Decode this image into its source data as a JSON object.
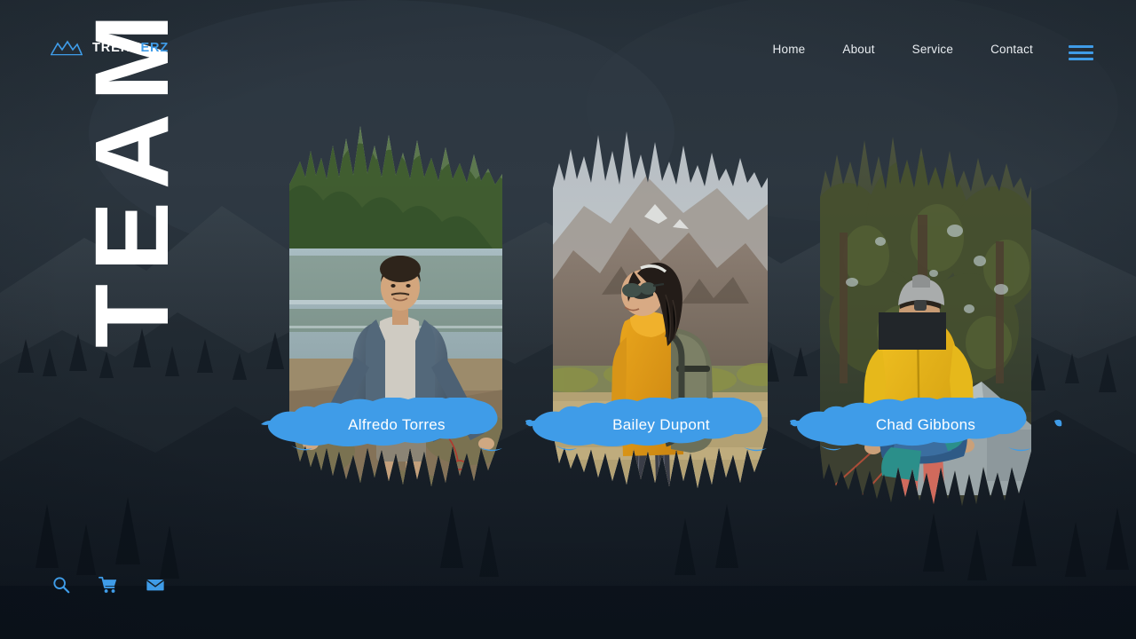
{
  "site": {
    "brand_primary": "TREKK",
    "brand_accent": "ERZ",
    "logo_icon": "mountain-icon",
    "accent_color": "#3f9ce8",
    "background_color": "#1d2731",
    "text_color": "#ffffff"
  },
  "nav": {
    "items": [
      {
        "label": "Home"
      },
      {
        "label": "About"
      },
      {
        "label": "Service"
      },
      {
        "label": "Contact"
      }
    ],
    "menu_icon": "hamburger-menu-icon"
  },
  "hero": {
    "section_title": "TEAM"
  },
  "team": {
    "members": [
      {
        "name": "Alfredo Torres",
        "photo_alt": "man in denim jacket standing by a lake",
        "badge_color": "#3f9ce8"
      },
      {
        "name": "Bailey Dupont",
        "photo_alt": "woman with sunglasses and green backpack in the desert",
        "badge_color": "#3f9ce8"
      },
      {
        "name": "Chad Gibbons",
        "photo_alt": "man in yellow jacket setting up a tent in the forest",
        "badge_color": "#3f9ce8"
      }
    ]
  },
  "utility": {
    "icons": [
      {
        "name": "search-icon",
        "label": "Search"
      },
      {
        "name": "cart-icon",
        "label": "Cart"
      },
      {
        "name": "mail-icon",
        "label": "Mail"
      }
    ]
  }
}
